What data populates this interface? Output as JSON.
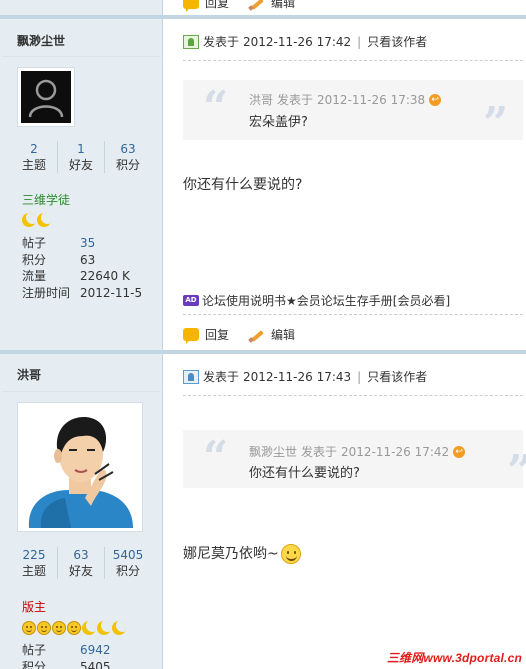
{
  "top_actions": {
    "reply": "回复",
    "edit": "编辑"
  },
  "post1": {
    "author": "飘渺尘世",
    "stats": [
      {
        "value": "2",
        "label": "主题"
      },
      {
        "value": "1",
        "label": "好友"
      },
      {
        "value": "63",
        "label": "积分"
      }
    ],
    "rank": "三维学徒",
    "rank_color": "#2a8a2a",
    "info": [
      {
        "key": "帖子",
        "value": "35"
      },
      {
        "key": "积分",
        "value": "63"
      },
      {
        "key": "流量",
        "value": "22640 K"
      },
      {
        "key": "注册时间",
        "value": "2012-11-5"
      }
    ],
    "posted_label": "发表于",
    "posted_time": "2012-11-26 17:42",
    "only_author": "只看该作者",
    "quote": {
      "author": "洪哥",
      "posted_label": "发表于",
      "time": "2012-11-26 17:38",
      "text": "宏朵盖伊?"
    },
    "message": "你还有什么要说的?",
    "ad_text": "论坛使用说明书★会员论坛生存手册[会员必看]",
    "ad_badge": "AD",
    "reply": "回复",
    "edit": "编辑"
  },
  "post2": {
    "author": "洪哥",
    "stats": [
      {
        "value": "225",
        "label": "主题"
      },
      {
        "value": "63",
        "label": "好友"
      },
      {
        "value": "5405",
        "label": "积分"
      }
    ],
    "rank": "版主",
    "rank_color": "#cc0000",
    "info": [
      {
        "key": "帖子",
        "value": "6942"
      },
      {
        "key": "积分",
        "value": "5405"
      }
    ],
    "posted_label": "发表于",
    "posted_time": "2012-11-26 17:43",
    "only_author": "只看该作者",
    "quote": {
      "author": "飘渺尘世",
      "posted_label": "发表于",
      "time": "2012-11-26 17:42",
      "text": "你还有什么要说的?"
    },
    "message": "娜尼莫乃依哟~"
  },
  "watermark": "三维网www.3dportal.cn"
}
